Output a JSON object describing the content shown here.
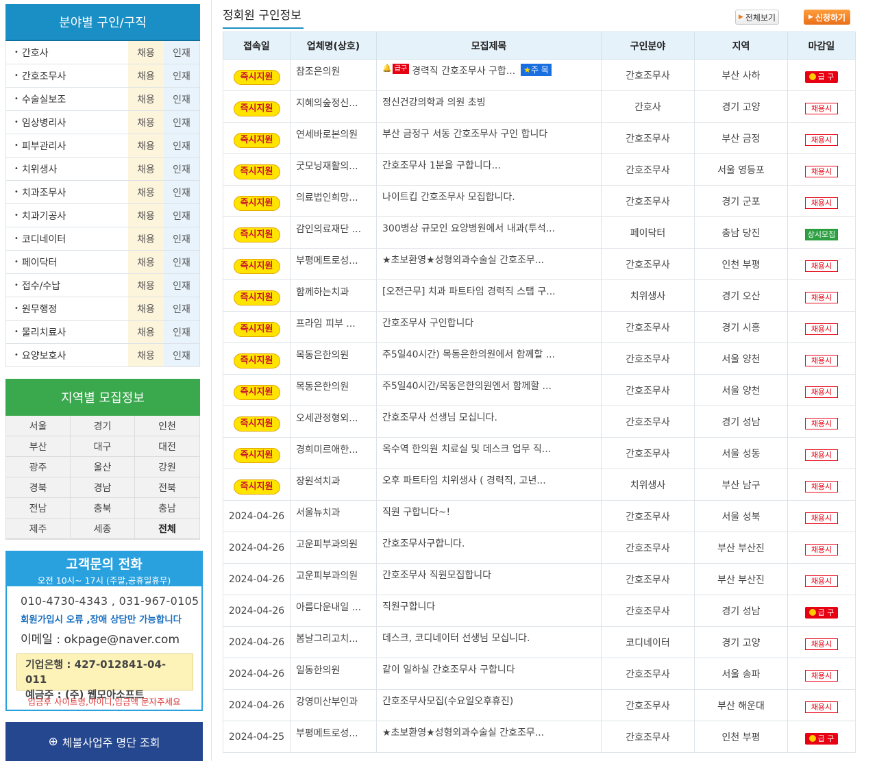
{
  "sidebar": {
    "field_title": "분야별 구인/구직",
    "hire_label": "채용",
    "seek_label": "인재",
    "fields": [
      "간호사",
      "간호조무사",
      "수술실보조",
      "임상병리사",
      "피부관리사",
      "치위생사",
      "치과조무사",
      "치과기공사",
      "코디네이터",
      "페이닥터",
      "접수/수납",
      "원무행정",
      "물리치료사",
      "요양보호사"
    ],
    "region_title": "지역별 모집정보",
    "regions": [
      "서울",
      "경기",
      "인천",
      "부산",
      "대구",
      "대전",
      "광주",
      "울산",
      "강원",
      "경북",
      "경남",
      "전북",
      "전남",
      "충북",
      "충남",
      "제주",
      "세종",
      "전체"
    ],
    "cs": {
      "title": "고객문의 전화",
      "hours": "오전 10시~ 17시 (주말,공휴일휴무)",
      "phone": "010-4730-4343 , 031-967-0105",
      "note": "회원가입시 오류 ,장애 상담만 가능합니다",
      "email": "이메일 : okpage@naver.com",
      "bank": "기업은행 : 427-012841-04-011",
      "holder": "예금주 : (주) 웹모아소프트",
      "warn": "입금후 사이트명,아이디,입금액  문자주세요"
    },
    "blacklist_label": "체불사업주 명단 조회"
  },
  "main": {
    "title": "정회원 구인정보",
    "view_all": "전체보기",
    "apply": "신청하기",
    "columns": [
      "접속일",
      "업체명(상호)",
      "모집제목",
      "구인분야",
      "지역",
      "마감일"
    ],
    "labels": {
      "now": "즉시지원",
      "urgent": "급 구",
      "hire": "채용시",
      "always": "상시모집",
      "tag_urgent": "급구",
      "tag_star": "주 목"
    },
    "rows": [
      {
        "date": "즉시지원",
        "company": "참조은의원",
        "title": "경력직 간호조무사 구합...",
        "field": "간호조무사",
        "region": "부산 사하",
        "deadline": "급 구",
        "urgent": true,
        "star": true
      },
      {
        "date": "즉시지원",
        "company": "지혜의숲정신...",
        "title": "정신건강의학과 의원 초빙",
        "field": "간호사",
        "region": "경기 고양",
        "deadline": "채용시"
      },
      {
        "date": "즉시지원",
        "company": "연세바로본의원",
        "title": "부산 금정구 서동 간호조무사 구인 합니다",
        "field": "간호조무사",
        "region": "부산 금정",
        "deadline": "채용시"
      },
      {
        "date": "즉시지원",
        "company": "굿모닝재활의...",
        "title": "간호조무사 1분을 구합니다...",
        "field": "간호조무사",
        "region": "서울 영등포",
        "deadline": "채용시"
      },
      {
        "date": "즉시지원",
        "company": "의료법인희망...",
        "title": "나이트킵 간호조무사 모집합니다.",
        "field": "간호조무사",
        "region": "경기 군포",
        "deadline": "채용시"
      },
      {
        "date": "즉시지원",
        "company": "감인의료재단 ...",
        "title": "300병상 규모인 요양병원에서 내과(투석...",
        "field": "페이닥터",
        "region": "충남 당진",
        "deadline": "상시모집"
      },
      {
        "date": "즉시지원",
        "company": "부평메트로성...",
        "title": "★초보환영★성형외과수술실 간호조무...",
        "field": "간호조무사",
        "region": "인천 부평",
        "deadline": "채용시"
      },
      {
        "date": "즉시지원",
        "company": "함께하는치과",
        "title": "[오전근무] 치과 파트타임 경력직 스탭 구...",
        "field": "치위생사",
        "region": "경기 오산",
        "deadline": "채용시"
      },
      {
        "date": "즉시지원",
        "company": "프라임 피부 ...",
        "title": "간호조무사 구인합니다",
        "field": "간호조무사",
        "region": "경기 시흥",
        "deadline": "채용시"
      },
      {
        "date": "즉시지원",
        "company": "목동은한의원",
        "title": "주5일40시간) 목동은한의원에서 함께할 ...",
        "field": "간호조무사",
        "region": "서울 양천",
        "deadline": "채용시"
      },
      {
        "date": "즉시지원",
        "company": "목동은한의원",
        "title": "주5일40시간/목동은한의원엔서 함께할 ...",
        "field": "간호조무사",
        "region": "서울 양천",
        "deadline": "채용시"
      },
      {
        "date": "즉시지원",
        "company": "오세관정형외...",
        "title": "간호조무사 선생님 모십니다.",
        "field": "간호조무사",
        "region": "경기 성남",
        "deadline": "채용시"
      },
      {
        "date": "즉시지원",
        "company": "경희미르애한...",
        "title": "옥수역 한의원 치료실 및 데스크 업무 직...",
        "field": "간호조무사",
        "region": "서울 성동",
        "deadline": "채용시"
      },
      {
        "date": "즉시지원",
        "company": "장원석치과",
        "title": "오후 파트타임 치위생사 ( 경력직, 고년...",
        "field": "치위생사",
        "region": "부산 남구",
        "deadline": "채용시"
      },
      {
        "date": "2024-04-26",
        "company": "서울뉴치과",
        "title": "직원 구합니다~!",
        "field": "간호조무사",
        "region": "서울 성북",
        "deadline": "채용시"
      },
      {
        "date": "2024-04-26",
        "company": "고운피부과의원",
        "title": "간호조무사구합니다.",
        "field": "간호조무사",
        "region": "부산 부산진",
        "deadline": "채용시"
      },
      {
        "date": "2024-04-26",
        "company": "고운피부과의원",
        "title": "간호조무사 직원모집합니다",
        "field": "간호조무사",
        "region": "부산 부산진",
        "deadline": "채용시"
      },
      {
        "date": "2024-04-26",
        "company": "아름다운내일 ...",
        "title": "직원구합니다",
        "field": "간호조무사",
        "region": "경기 성남",
        "deadline": "급 구"
      },
      {
        "date": "2024-04-26",
        "company": "봄날그리고치...",
        "title": "데스크, 코디네이터 선생님 모십니다.",
        "field": "코디네이터",
        "region": "경기 고양",
        "deadline": "채용시"
      },
      {
        "date": "2024-04-26",
        "company": "일동한의원",
        "title": "같이 일하실 간호조무사 구합니다",
        "field": "간호조무사",
        "region": "서울 송파",
        "deadline": "채용시"
      },
      {
        "date": "2024-04-26",
        "company": "강영미산부인과",
        "title": "간호조무사모집(수요일오후휴진)",
        "field": "간호조무사",
        "region": "부산 해운대",
        "deadline": "채용시"
      },
      {
        "date": "2024-04-25",
        "company": "부평메트로성...",
        "title": "★초보환영★성형외과수술실 간호조무...",
        "field": "간호조무사",
        "region": "인천 부평",
        "deadline": "급 구"
      }
    ]
  },
  "colors": {
    "sidebar_blue": "#1a8fc6",
    "region_green": "#3aa84d",
    "navy": "#24478f",
    "urgent_red": "#e60012",
    "pill_yellow": "#ffe400"
  }
}
